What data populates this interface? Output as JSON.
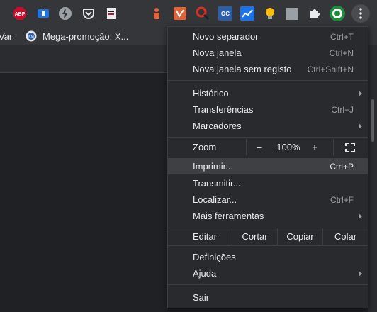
{
  "toolbar": {
    "extensions": [
      {
        "icon": "adblock-plus-icon",
        "text": "ABP",
        "color": "#c70d2c"
      },
      {
        "icon": "extension-blue-icon",
        "text": "",
        "color": "#1a73e8"
      },
      {
        "icon": "lightning-icon",
        "text": "",
        "color": "#9aa0a6"
      },
      {
        "icon": "pocket-icon",
        "text": "",
        "color": "#e8eaed"
      },
      {
        "icon": "code-extension-icon",
        "text": "",
        "color": "#e8eaed"
      },
      {
        "icon": "figure-extension-icon",
        "text": "",
        "color": "#e0643a"
      },
      {
        "icon": "vpn-extension-icon",
        "text": "",
        "color": "#e0643a"
      },
      {
        "icon": "magnifier-extension-icon",
        "text": "",
        "color": "#d93025"
      },
      {
        "icon": "oc-extension-icon",
        "text": "OC",
        "color": "#2f5ea8"
      },
      {
        "icon": "chart-extension-icon",
        "text": "",
        "color": "#1a73e8"
      },
      {
        "icon": "lightbulb-icon",
        "text": "",
        "color": "#fbbc04"
      },
      {
        "icon": "gray-square-icon",
        "text": "",
        "color": "#9aa0a6"
      },
      {
        "icon": "puzzle-icon",
        "text": "",
        "color": "#e8eaed"
      },
      {
        "icon": "profile-avatar-icon",
        "text": "",
        "color": "#1e8e3e"
      }
    ]
  },
  "bookmarks": {
    "partial_label": "Var",
    "item_label": "Mega-promoção: X..."
  },
  "menu": {
    "new_tab": {
      "label": "Novo separador",
      "shortcut": "Ctrl+T"
    },
    "new_window": {
      "label": "Nova janela",
      "shortcut": "Ctrl+N"
    },
    "incognito": {
      "label": "Nova janela sem registo",
      "shortcut": "Ctrl+Shift+N"
    },
    "history": {
      "label": "Histórico"
    },
    "downloads": {
      "label": "Transferências",
      "shortcut": "Ctrl+J"
    },
    "bookmarks": {
      "label": "Marcadores"
    },
    "zoom": {
      "label": "Zoom",
      "minus": "–",
      "value": "100%",
      "plus": "+"
    },
    "print": {
      "label": "Imprimir...",
      "shortcut": "Ctrl+P"
    },
    "cast": {
      "label": "Transmitir..."
    },
    "find": {
      "label": "Localizar...",
      "shortcut": "Ctrl+F"
    },
    "more_tools": {
      "label": "Mais ferramentas"
    },
    "edit": {
      "label": "Editar",
      "cut": "Cortar",
      "copy": "Copiar",
      "paste": "Colar"
    },
    "settings": {
      "label": "Definições"
    },
    "help": {
      "label": "Ajuda"
    },
    "exit": {
      "label": "Sair"
    }
  }
}
